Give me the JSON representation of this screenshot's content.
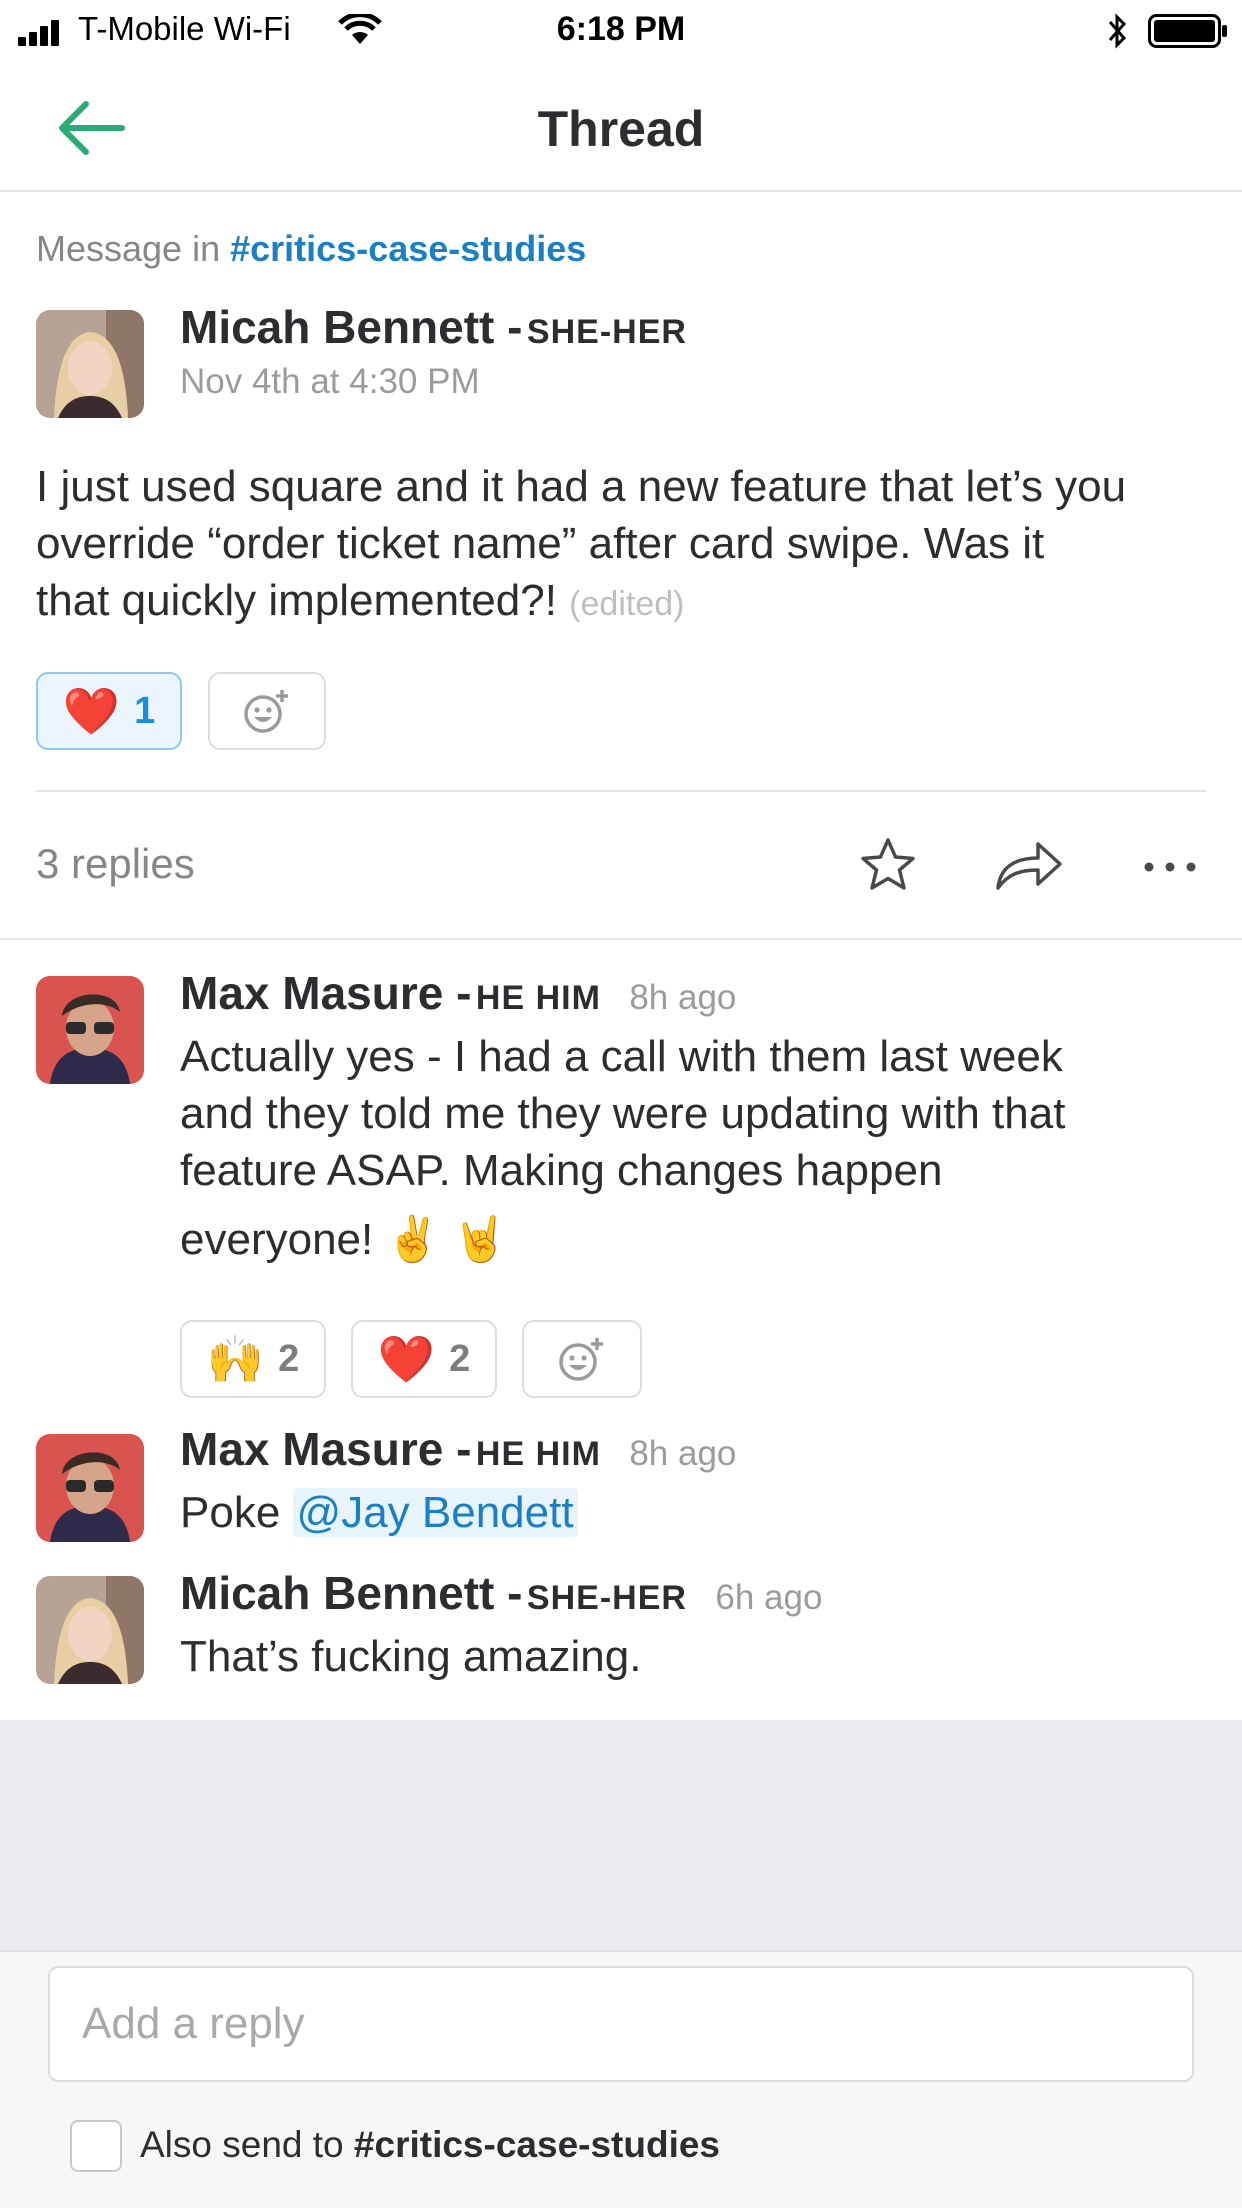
{
  "status_bar": {
    "carrier": "T-Mobile Wi-Fi",
    "time": "6:18 PM"
  },
  "header": {
    "title": "Thread"
  },
  "thread": {
    "message_in_prefix": "Message in",
    "channel": "#critics-case-studies",
    "parent": {
      "author": "Micah Bennett -",
      "pronouns": "SHE-HER",
      "timestamp": "Nov 4th at 4:30 PM",
      "text_lines": [
        "I just used square and it had a new feature that let’s you",
        "override “order ticket name” after card swipe. Was it",
        "that quickly implemented?!"
      ],
      "edited": "(edited)",
      "reactions": [
        {
          "emoji": "❤️",
          "count": "1",
          "active": true
        }
      ]
    },
    "replies_count": "3 replies",
    "replies": [
      {
        "author": "Max Masure -",
        "pronouns": "HE HIM",
        "timestamp": "8h ago",
        "text_lines": [
          "Actually yes - I had a call with them last week",
          "and they told me they were updating with that",
          "feature ASAP. Making changes happen",
          "everyone! ✌️ 🤘"
        ],
        "reactions": [
          {
            "emoji": "🙌",
            "count": "2"
          },
          {
            "emoji": "❤️",
            "count": "2"
          }
        ]
      },
      {
        "author": "Max Masure -",
        "pronouns": "HE HIM",
        "timestamp": "8h ago",
        "text_prefix": "Poke",
        "mention": "@Jay Bendett"
      },
      {
        "author": "Micah Bennett -",
        "pronouns": "SHE-HER",
        "timestamp": "6h ago",
        "text": "That’s fucking amazing."
      }
    ]
  },
  "composer": {
    "placeholder": "Add a reply",
    "also_send_prefix": "Also send to",
    "also_send_channel": "#critics-case-studies"
  },
  "colors": {
    "accent": "#1a7fc4",
    "back_arrow": "#2bac76",
    "reaction_active_bg": "#eaf5fd"
  }
}
